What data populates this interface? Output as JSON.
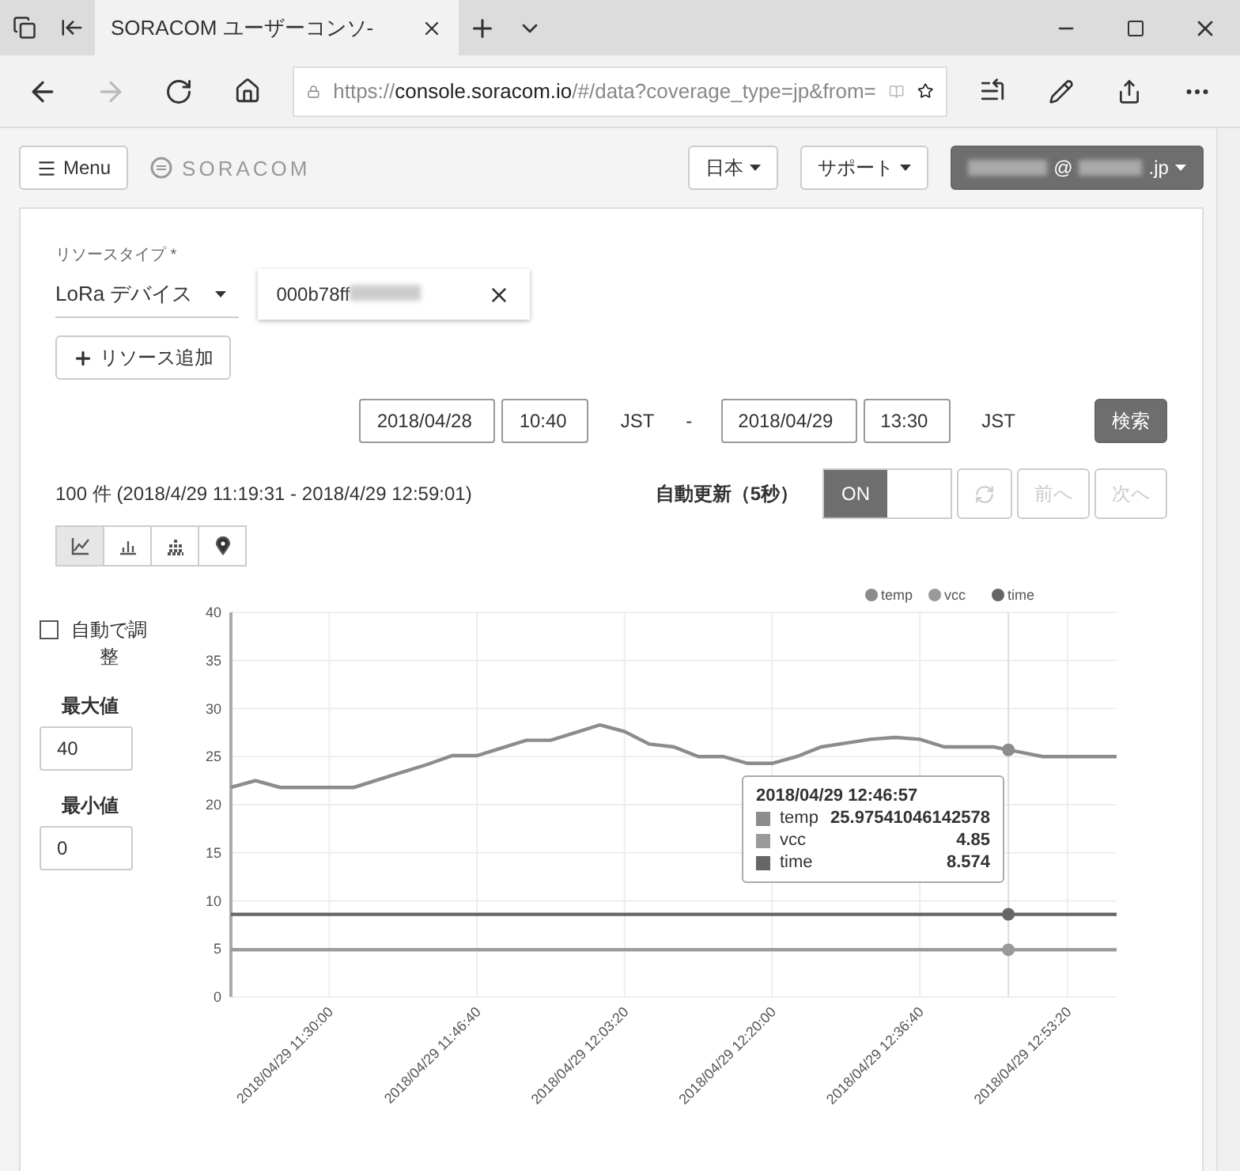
{
  "browser": {
    "tabs": [
      {
        "title": "SORACOM ユーザーコンソ-",
        "selected": true
      }
    ],
    "url": {
      "prefix": "https://",
      "host": "console.soracom.io",
      "rest": "/#/data?coverage_type=jp&from="
    }
  },
  "navbar": {
    "menu": "Menu",
    "logo": "SORACOM",
    "language": "日本",
    "support": "サポート",
    "account": [
      "@",
      ".jp"
    ]
  },
  "resource": {
    "type_label": "リソースタイプ *",
    "type_value": "LoRa デバイス",
    "id": "000b78ff",
    "add_button": "リソース追加"
  },
  "range": {
    "from_date": "2018/04/28",
    "from_time": "10:40",
    "from_tz": "JST",
    "separator": "-",
    "to_date": "2018/04/29",
    "to_time": "13:30",
    "to_tz": "JST",
    "search_button": "検索"
  },
  "summary": "100 件 (2018/4/29 11:19:31 - 2018/4/29 12:59:01)",
  "auto_refresh": {
    "label": "自動更新（5秒）",
    "on": true,
    "on_label": "ON",
    "prev": "前へ",
    "next": "次へ"
  },
  "chart_types": [
    {
      "kind": "line",
      "selected": true
    },
    {
      "kind": "bar",
      "selected": false
    },
    {
      "kind": "stacked",
      "selected": false
    },
    {
      "kind": "map",
      "selected": false
    }
  ],
  "axis_controls": {
    "auto_label": "自動で調整",
    "auto_checked": false,
    "max_label": "最大値",
    "max_value": "40",
    "min_label": "最小値",
    "min_value": "0"
  },
  "chart": {
    "chart_data": {
      "type": "line",
      "categories": [
        null,
        null,
        null,
        null,
        "2018/04/29 11:30:00",
        null,
        null,
        null,
        null,
        null,
        "2018/04/29 11:46:40",
        null,
        null,
        null,
        null,
        null,
        "2018/04/29 12:03:20",
        null,
        null,
        null,
        null,
        null,
        "2018/04/29 12:20:00",
        null,
        null,
        null,
        null,
        null,
        "2018/04/29 12:36:40",
        null,
        null,
        null,
        null,
        null,
        "2018/04/29 12:53:20",
        null,
        null
      ],
      "series": [
        {
          "name": "temp",
          "color": "#8c8c8c",
          "values": [
            21.8,
            22.5,
            21.8,
            21.8,
            21.8,
            21.8,
            22.6,
            23.4,
            24.2,
            25.1,
            25.1,
            25.9,
            26.7,
            26.7,
            27.5,
            28.3,
            27.6,
            26.3,
            26.0,
            25.0,
            25.0,
            24.3,
            24.3,
            25.0,
            26.0,
            26.4,
            26.8,
            27.0,
            26.8,
            26.0,
            26.0,
            26.0,
            25.5,
            25.0,
            25.0,
            25.0,
            25.0
          ]
        },
        {
          "name": "vcc",
          "color": "#9a9a9a",
          "values": [
            4.9,
            4.9,
            4.9,
            4.9,
            4.9,
            4.9,
            4.9,
            4.9,
            4.9,
            4.9,
            4.9,
            4.9,
            4.9,
            4.9,
            4.9,
            4.9,
            4.9,
            4.9,
            4.9,
            4.9,
            4.9,
            4.9,
            4.9,
            4.9,
            4.9,
            4.9,
            4.9,
            4.9,
            4.9,
            4.9,
            4.9,
            4.9,
            4.9,
            4.9,
            4.9,
            4.9,
            4.9
          ]
        },
        {
          "name": "time",
          "color": "#666666",
          "values": [
            8.6,
            8.6,
            8.6,
            8.6,
            8.6,
            8.6,
            8.6,
            8.6,
            8.6,
            8.6,
            8.6,
            8.6,
            8.6,
            8.6,
            8.6,
            8.6,
            8.6,
            8.6,
            8.6,
            8.6,
            8.6,
            8.6,
            8.6,
            8.6,
            8.6,
            8.6,
            8.6,
            8.6,
            8.6,
            8.6,
            8.6,
            8.6,
            8.6,
            8.6,
            8.6,
            8.6,
            8.6
          ]
        }
      ],
      "ylim": [
        0,
        40
      ],
      "yticks": [
        0,
        5,
        10,
        15,
        20,
        25,
        30,
        35,
        40
      ],
      "grid": true,
      "legend": "top-right"
    },
    "tooltip": {
      "title": "2018/04/29 12:46:57",
      "rows": [
        {
          "name": "temp",
          "value": "25.97541046142578"
        },
        {
          "name": "vcc",
          "value": "4.85"
        },
        {
          "name": "time",
          "value": "8.574"
        }
      ]
    }
  }
}
